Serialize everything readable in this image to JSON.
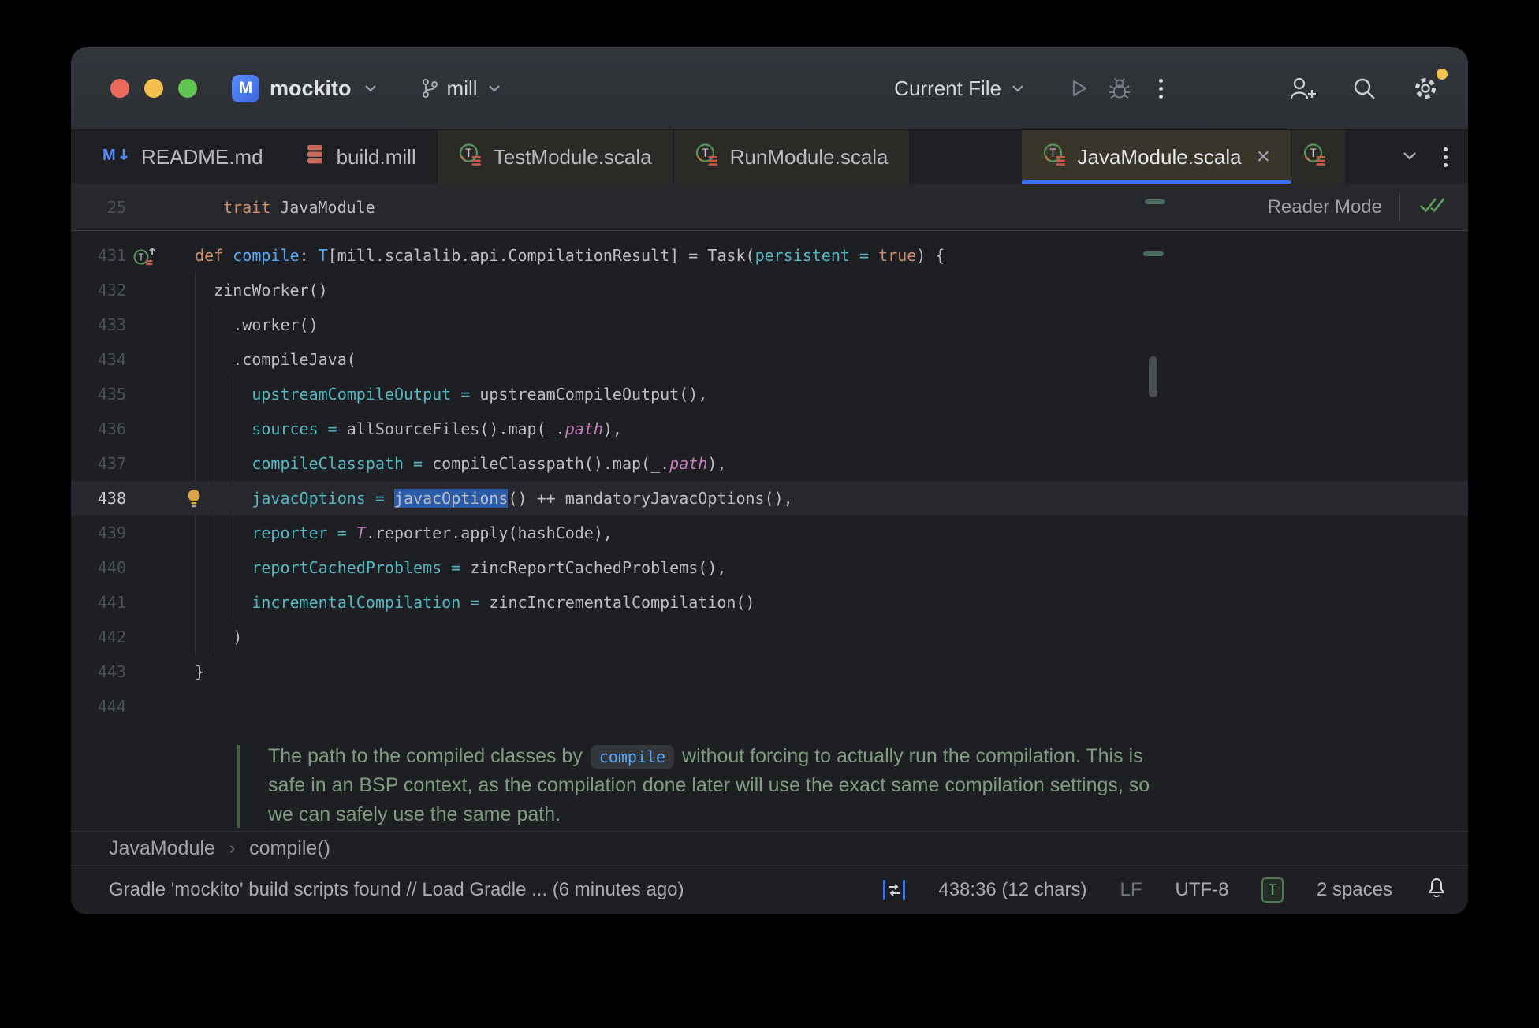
{
  "titlebar": {
    "project": {
      "initial": "M",
      "name": "mockito"
    },
    "branch": {
      "name": "mill"
    },
    "run_config": "Current File"
  },
  "tabs": [
    {
      "label": "README.md",
      "icon": "markdown-icon",
      "state": "normal"
    },
    {
      "label": "build.mill",
      "icon": "mill-icon",
      "state": "normal"
    },
    {
      "label": "TestModule.scala",
      "icon": "scala-trait-icon",
      "state": "library"
    },
    {
      "label": "RunModule.scala",
      "icon": "scala-trait-icon",
      "state": "library"
    },
    {
      "label": "JavaModule.scala",
      "icon": "scala-trait-icon",
      "state": "active",
      "closable": true
    },
    {
      "label": "",
      "icon": "scala-trait-icon",
      "state": "partial"
    }
  ],
  "sticky": {
    "line_number": "25",
    "tokens": [
      {
        "t": "trait",
        "c": "kw"
      },
      {
        "t": " JavaModule",
        "c": "pl"
      }
    ],
    "reader_mode_label": "Reader Mode"
  },
  "editor": {
    "lines": [
      {
        "num": "431",
        "gutter": "overrides-marker-icon",
        "tokens": [
          {
            "t": "  ",
            "c": "pl"
          },
          {
            "t": "def",
            "c": "kw"
          },
          {
            "t": " ",
            "c": "pl"
          },
          {
            "t": "compile",
            "c": "fn"
          },
          {
            "t": ": ",
            "c": "pl"
          },
          {
            "t": "T",
            "c": "ty"
          },
          {
            "t": "[mill.scalalib.api.CompilationResult] = Task(",
            "c": "pl"
          },
          {
            "t": "persistent",
            "c": "np"
          },
          {
            "t": " ",
            "c": "pl"
          },
          {
            "t": "=",
            "c": "np"
          },
          {
            "t": " ",
            "c": "pl"
          },
          {
            "t": "true",
            "c": "kw"
          },
          {
            "t": ") {",
            "c": "pl"
          }
        ]
      },
      {
        "num": "432",
        "tokens": [
          {
            "t": "    zincWorker()",
            "c": "pl"
          }
        ]
      },
      {
        "num": "433",
        "tokens": [
          {
            "t": "      .worker()",
            "c": "pl"
          }
        ]
      },
      {
        "num": "434",
        "tokens": [
          {
            "t": "      .compileJava(",
            "c": "pl"
          }
        ]
      },
      {
        "num": "435",
        "tokens": [
          {
            "t": "        ",
            "c": "pl"
          },
          {
            "t": "upstreamCompileOutput",
            "c": "np"
          },
          {
            "t": " ",
            "c": "pl"
          },
          {
            "t": "=",
            "c": "np"
          },
          {
            "t": " upstreamCompileOutput(),",
            "c": "pl"
          }
        ]
      },
      {
        "num": "436",
        "tokens": [
          {
            "t": "        ",
            "c": "pl"
          },
          {
            "t": "sources",
            "c": "np"
          },
          {
            "t": " ",
            "c": "pl"
          },
          {
            "t": "=",
            "c": "np"
          },
          {
            "t": " allSourceFiles().map(_.",
            "c": "pl"
          },
          {
            "t": "path",
            "c": "it"
          },
          {
            "t": "),",
            "c": "pl"
          }
        ]
      },
      {
        "num": "437",
        "tokens": [
          {
            "t": "        ",
            "c": "pl"
          },
          {
            "t": "compileClasspath",
            "c": "np"
          },
          {
            "t": " ",
            "c": "pl"
          },
          {
            "t": "=",
            "c": "np"
          },
          {
            "t": " compileClasspath().map(_.",
            "c": "pl"
          },
          {
            "t": "path",
            "c": "it"
          },
          {
            "t": "),",
            "c": "pl"
          }
        ]
      },
      {
        "num": "438",
        "active": true,
        "gutter": "intention-bulb-icon",
        "tokens": [
          {
            "t": "        ",
            "c": "pl"
          },
          {
            "t": "javacOptions",
            "c": "np"
          },
          {
            "t": " ",
            "c": "pl"
          },
          {
            "t": "=",
            "c": "np"
          },
          {
            "t": " ",
            "c": "pl"
          },
          {
            "t": "javacOptions",
            "c": "pl sel"
          },
          {
            "t": "() ++ mandatoryJavacOptions(),",
            "c": "pl"
          }
        ]
      },
      {
        "num": "439",
        "tokens": [
          {
            "t": "        ",
            "c": "pl"
          },
          {
            "t": "reporter",
            "c": "np"
          },
          {
            "t": " ",
            "c": "pl"
          },
          {
            "t": "=",
            "c": "np"
          },
          {
            "t": " ",
            "c": "pl"
          },
          {
            "t": "T",
            "c": "it"
          },
          {
            "t": ".reporter.apply(hashCode),",
            "c": "pl"
          }
        ]
      },
      {
        "num": "440",
        "tokens": [
          {
            "t": "        ",
            "c": "pl"
          },
          {
            "t": "reportCachedProblems",
            "c": "np"
          },
          {
            "t": " ",
            "c": "pl"
          },
          {
            "t": "=",
            "c": "np"
          },
          {
            "t": " zincReportCachedProblems(),",
            "c": "pl"
          }
        ]
      },
      {
        "num": "441",
        "tokens": [
          {
            "t": "        ",
            "c": "pl"
          },
          {
            "t": "incrementalCompilation",
            "c": "np"
          },
          {
            "t": " ",
            "c": "pl"
          },
          {
            "t": "=",
            "c": "np"
          },
          {
            "t": " zincIncrementalCompilation()",
            "c": "pl"
          }
        ]
      },
      {
        "num": "442",
        "tokens": [
          {
            "t": "      )",
            "c": "pl"
          }
        ]
      },
      {
        "num": "443",
        "tokens": [
          {
            "t": "  }",
            "c": "pl"
          }
        ]
      },
      {
        "num": "444",
        "tokens": []
      }
    ],
    "doc_lines": [
      [
        {
          "t": "The path to the compiled classes by ",
          "c": "doc"
        },
        {
          "t": "compile",
          "c": "chip"
        },
        {
          "t": " without forcing to actually run the compilation. This is",
          "c": "doc"
        }
      ],
      [
        {
          "t": "safe in an BSP context, as the compilation done later will use the exact same compilation settings, so",
          "c": "doc"
        }
      ],
      [
        {
          "t": "we can safely use the same path.",
          "c": "doc"
        }
      ]
    ]
  },
  "breadcrumbs": {
    "items": [
      "JavaModule",
      "compile()"
    ],
    "separator": "›"
  },
  "status_bar": {
    "message": "Gradle 'mockito' build scripts found // Load Gradle ... (6 minutes ago)",
    "caret": "438:36 (12 chars)",
    "line_ending": "LF",
    "encoding": "UTF-8",
    "badge": "T",
    "indent": "2 spaces"
  },
  "colors": {
    "accent_blue": "#3574F0",
    "selection": "#2B5CA9",
    "keyword": "#CF8E6D",
    "function": "#56A8F5",
    "named_arg": "#56B6C2",
    "purple_italic": "#C77DBB",
    "doc_green": "#7F9C80",
    "editor_bg": "#1E1F22",
    "active_tab_bg": "#3A352B"
  }
}
